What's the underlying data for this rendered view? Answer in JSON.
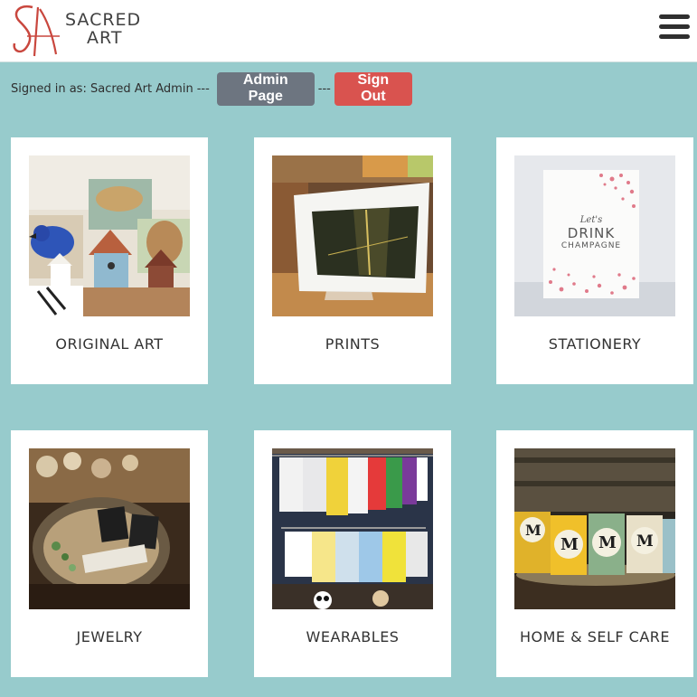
{
  "header": {
    "logo_mark": "SA",
    "logo_line1": "SACRED",
    "logo_line2": "ART",
    "menu_icon": "hamburger-menu-icon"
  },
  "admin_bar": {
    "signed_in_text": "Signed in as: Sacred Art Admin",
    "separator": "---",
    "admin_button": "Admin Page",
    "signout_button": "Sign Out"
  },
  "categories": [
    {
      "label": "ORIGINAL ART"
    },
    {
      "label": "PRINTS"
    },
    {
      "label": "STATIONERY"
    },
    {
      "label": "JEWELRY"
    },
    {
      "label": "WEARABLES"
    },
    {
      "label": "HOME & SELF CARE"
    }
  ],
  "photo_text": {
    "stationery_line1": "Let's",
    "stationery_line2": "DRINK",
    "stationery_line3": "CHAMPAGNE"
  },
  "colors": {
    "background": "#97cbcc",
    "admin_button": "#6d7580",
    "signout_button": "#d9534f",
    "logo_red": "#c9473e"
  }
}
